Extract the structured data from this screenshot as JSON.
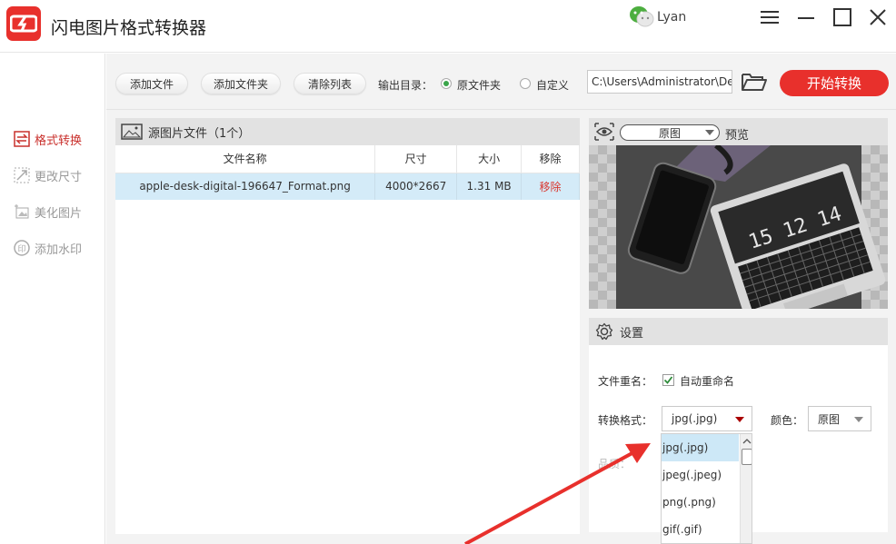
{
  "app": {
    "title": "闪电图片格式转换器",
    "user": "Lyan"
  },
  "window_controls": [
    "menu-icon",
    "minimize-icon",
    "maximize-icon",
    "close-icon"
  ],
  "sidebar": {
    "items": [
      {
        "label": "格式转换",
        "icon": "swap-icon",
        "active": true
      },
      {
        "label": "更改尺寸",
        "icon": "resize-icon",
        "active": false
      },
      {
        "label": "美化图片",
        "icon": "beautify-icon",
        "active": false
      },
      {
        "label": "添加水印",
        "icon": "watermark-icon",
        "active": false
      }
    ]
  },
  "toolbar": {
    "add_file": "添加文件",
    "add_folder": "添加文件夹",
    "clear_list": "清除列表",
    "output_dir_label": "输出目录：",
    "option_source": "原文件夹",
    "option_custom": "自定义",
    "output_path": "C:\\Users\\Administrator\\De",
    "start": "开始转换",
    "selected_option": "原文件夹"
  },
  "files": {
    "header": "源图片文件（1个）",
    "columns": [
      "文件名称",
      "尺寸",
      "大小",
      "移除"
    ],
    "rows": [
      {
        "name": "apple-desk-digital-196647_Format.png",
        "size": "4000*2667",
        "filesize": "1.31 MB",
        "action": "移除"
      }
    ]
  },
  "preview": {
    "mode": "原图",
    "label": "预览",
    "clock_text": "15 12 14"
  },
  "settings": {
    "title": "设置",
    "rename_label": "文件重名：",
    "auto_rename": "自动重命名",
    "auto_rename_checked": true,
    "format_label": "转换格式：",
    "format_value": "jpg(.jpg)",
    "color_label": "颜色：",
    "color_value": "原图",
    "quality_label_partial": "品质：",
    "format_options": [
      "jpg(.jpg)",
      "jpeg(.jpeg)",
      "png(.png)",
      "gif(.gif)"
    ]
  },
  "colors": {
    "accent": "#e8302c",
    "active_sidebar": "#c9302c",
    "selected_row": "#d4ebf8",
    "annotation_arrow": "#e8302c"
  }
}
